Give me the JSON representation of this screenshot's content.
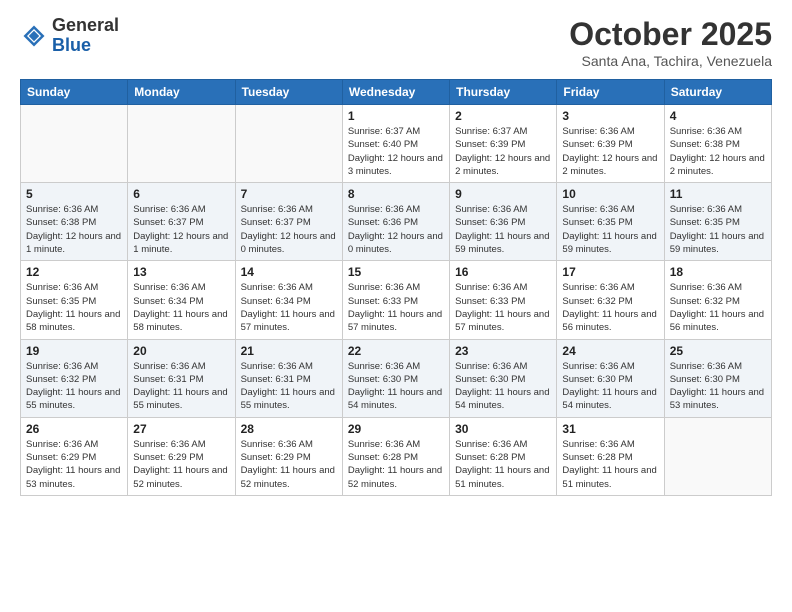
{
  "logo": {
    "general": "General",
    "blue": "Blue"
  },
  "header": {
    "month": "October 2025",
    "location": "Santa Ana, Tachira, Venezuela"
  },
  "weekdays": [
    "Sunday",
    "Monday",
    "Tuesday",
    "Wednesday",
    "Thursday",
    "Friday",
    "Saturday"
  ],
  "weeks": [
    [
      {
        "day": "",
        "info": ""
      },
      {
        "day": "",
        "info": ""
      },
      {
        "day": "",
        "info": ""
      },
      {
        "day": "1",
        "info": "Sunrise: 6:37 AM\nSunset: 6:40 PM\nDaylight: 12 hours and 3 minutes."
      },
      {
        "day": "2",
        "info": "Sunrise: 6:37 AM\nSunset: 6:39 PM\nDaylight: 12 hours and 2 minutes."
      },
      {
        "day": "3",
        "info": "Sunrise: 6:36 AM\nSunset: 6:39 PM\nDaylight: 12 hours and 2 minutes."
      },
      {
        "day": "4",
        "info": "Sunrise: 6:36 AM\nSunset: 6:38 PM\nDaylight: 12 hours and 2 minutes."
      }
    ],
    [
      {
        "day": "5",
        "info": "Sunrise: 6:36 AM\nSunset: 6:38 PM\nDaylight: 12 hours and 1 minute."
      },
      {
        "day": "6",
        "info": "Sunrise: 6:36 AM\nSunset: 6:37 PM\nDaylight: 12 hours and 1 minute."
      },
      {
        "day": "7",
        "info": "Sunrise: 6:36 AM\nSunset: 6:37 PM\nDaylight: 12 hours and 0 minutes."
      },
      {
        "day": "8",
        "info": "Sunrise: 6:36 AM\nSunset: 6:36 PM\nDaylight: 12 hours and 0 minutes."
      },
      {
        "day": "9",
        "info": "Sunrise: 6:36 AM\nSunset: 6:36 PM\nDaylight: 11 hours and 59 minutes."
      },
      {
        "day": "10",
        "info": "Sunrise: 6:36 AM\nSunset: 6:35 PM\nDaylight: 11 hours and 59 minutes."
      },
      {
        "day": "11",
        "info": "Sunrise: 6:36 AM\nSunset: 6:35 PM\nDaylight: 11 hours and 59 minutes."
      }
    ],
    [
      {
        "day": "12",
        "info": "Sunrise: 6:36 AM\nSunset: 6:35 PM\nDaylight: 11 hours and 58 minutes."
      },
      {
        "day": "13",
        "info": "Sunrise: 6:36 AM\nSunset: 6:34 PM\nDaylight: 11 hours and 58 minutes."
      },
      {
        "day": "14",
        "info": "Sunrise: 6:36 AM\nSunset: 6:34 PM\nDaylight: 11 hours and 57 minutes."
      },
      {
        "day": "15",
        "info": "Sunrise: 6:36 AM\nSunset: 6:33 PM\nDaylight: 11 hours and 57 minutes."
      },
      {
        "day": "16",
        "info": "Sunrise: 6:36 AM\nSunset: 6:33 PM\nDaylight: 11 hours and 57 minutes."
      },
      {
        "day": "17",
        "info": "Sunrise: 6:36 AM\nSunset: 6:32 PM\nDaylight: 11 hours and 56 minutes."
      },
      {
        "day": "18",
        "info": "Sunrise: 6:36 AM\nSunset: 6:32 PM\nDaylight: 11 hours and 56 minutes."
      }
    ],
    [
      {
        "day": "19",
        "info": "Sunrise: 6:36 AM\nSunset: 6:32 PM\nDaylight: 11 hours and 55 minutes."
      },
      {
        "day": "20",
        "info": "Sunrise: 6:36 AM\nSunset: 6:31 PM\nDaylight: 11 hours and 55 minutes."
      },
      {
        "day": "21",
        "info": "Sunrise: 6:36 AM\nSunset: 6:31 PM\nDaylight: 11 hours and 55 minutes."
      },
      {
        "day": "22",
        "info": "Sunrise: 6:36 AM\nSunset: 6:30 PM\nDaylight: 11 hours and 54 minutes."
      },
      {
        "day": "23",
        "info": "Sunrise: 6:36 AM\nSunset: 6:30 PM\nDaylight: 11 hours and 54 minutes."
      },
      {
        "day": "24",
        "info": "Sunrise: 6:36 AM\nSunset: 6:30 PM\nDaylight: 11 hours and 54 minutes."
      },
      {
        "day": "25",
        "info": "Sunrise: 6:36 AM\nSunset: 6:30 PM\nDaylight: 11 hours and 53 minutes."
      }
    ],
    [
      {
        "day": "26",
        "info": "Sunrise: 6:36 AM\nSunset: 6:29 PM\nDaylight: 11 hours and 53 minutes."
      },
      {
        "day": "27",
        "info": "Sunrise: 6:36 AM\nSunset: 6:29 PM\nDaylight: 11 hours and 52 minutes."
      },
      {
        "day": "28",
        "info": "Sunrise: 6:36 AM\nSunset: 6:29 PM\nDaylight: 11 hours and 52 minutes."
      },
      {
        "day": "29",
        "info": "Sunrise: 6:36 AM\nSunset: 6:28 PM\nDaylight: 11 hours and 52 minutes."
      },
      {
        "day": "30",
        "info": "Sunrise: 6:36 AM\nSunset: 6:28 PM\nDaylight: 11 hours and 51 minutes."
      },
      {
        "day": "31",
        "info": "Sunrise: 6:36 AM\nSunset: 6:28 PM\nDaylight: 11 hours and 51 minutes."
      },
      {
        "day": "",
        "info": ""
      }
    ]
  ]
}
